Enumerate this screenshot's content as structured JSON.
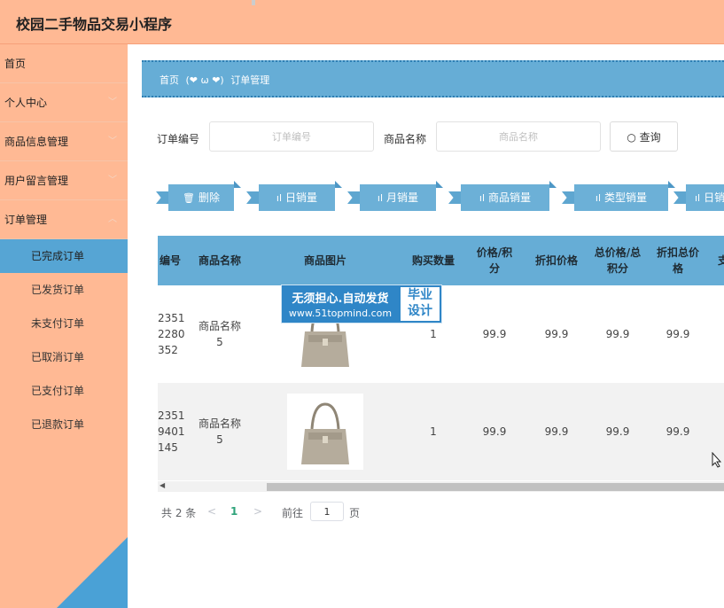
{
  "app": {
    "title": "校园二手物品交易小程序"
  },
  "sidebar": {
    "items": [
      {
        "label": "首页",
        "chevron": false
      },
      {
        "label": "个人中心",
        "chevron": true
      },
      {
        "label": "商品信息管理",
        "chevron": true
      },
      {
        "label": "用户留言管理",
        "chevron": true
      },
      {
        "label": "订单管理",
        "chevron": true
      }
    ],
    "subitems": [
      {
        "label": "已完成订单",
        "active": true
      },
      {
        "label": "已发货订单",
        "active": false
      },
      {
        "label": "未支付订单",
        "active": false
      },
      {
        "label": "已取消订单",
        "active": false
      },
      {
        "label": "已支付订单",
        "active": false
      },
      {
        "label": "已退款订单",
        "active": false
      }
    ]
  },
  "breadcrumb": {
    "home": "首页",
    "separator": "(❤ ω ❤)",
    "current": "订单管理"
  },
  "search": {
    "order_label": "订单编号",
    "order_placeholder": "订单编号",
    "product_label": "商品名称",
    "product_placeholder": "商品名称",
    "button_label": "查询"
  },
  "actions": {
    "delete": "删除",
    "daily_sales": "日销量",
    "monthly_sales": "月销量",
    "product_sales": "商品销量",
    "type_sales": "类型销量",
    "daily_sales_2": "日销"
  },
  "table": {
    "headers": {
      "order_no": "编号",
      "product_name": "商品名称",
      "product_image": "商品图片",
      "quantity": "购买数量",
      "price_points": "价格/积分",
      "discount_price": "折扣价格",
      "total_price": "总价格/总积分",
      "discount_total": "折扣总价格",
      "more": "支"
    },
    "rows": [
      {
        "order_no": "2351\n2280\n352",
        "product_name": "商品名称\n5",
        "quantity": "1",
        "price_points": "99.9",
        "discount_price": "99.9",
        "total_price": "99.9",
        "discount_total": "99.9"
      },
      {
        "order_no": "2351\n9401\n145",
        "product_name": "商品名称\n5",
        "quantity": "1",
        "price_points": "99.9",
        "discount_price": "99.9",
        "total_price": "99.9",
        "discount_total": "99.9"
      }
    ]
  },
  "pagination": {
    "total": "共 2 条",
    "prev": "<",
    "current_page": "1",
    "next": ">",
    "goto_label": "前往",
    "goto_value": "1",
    "page_suffix": "页"
  },
  "watermark": {
    "line1": "无须担心.自动发货",
    "line2": "www.51topmind.com",
    "badge_line1": "毕业",
    "badge_line2": "设计"
  },
  "colors": {
    "header_bg": "#ffb994",
    "accent_blue": "#66add6",
    "active_item": "#56a5d4"
  }
}
